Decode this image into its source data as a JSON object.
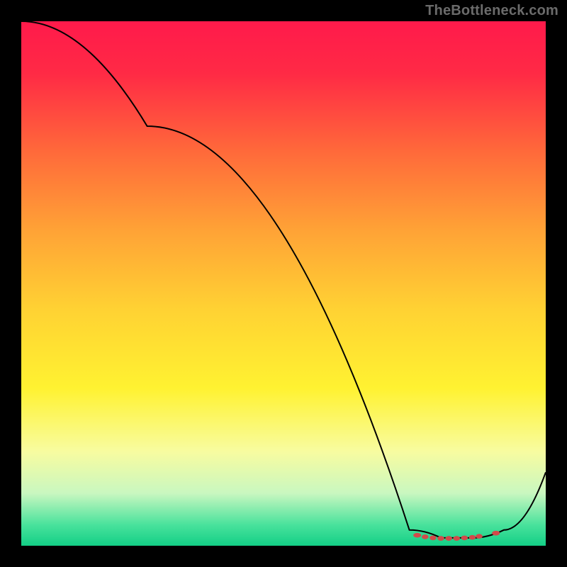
{
  "watermark": "TheBottleneck.com",
  "chart_data": {
    "type": "line",
    "title": "",
    "xlabel": "",
    "ylabel": "",
    "xlim": [
      0,
      100
    ],
    "ylim": [
      0,
      100
    ],
    "grid": false,
    "gradient_stops": [
      {
        "offset": 0.0,
        "color": "#ff1a4b"
      },
      {
        "offset": 0.1,
        "color": "#ff2a45"
      },
      {
        "offset": 0.25,
        "color": "#ff6a3a"
      },
      {
        "offset": 0.4,
        "color": "#ffa336"
      },
      {
        "offset": 0.55,
        "color": "#ffd233"
      },
      {
        "offset": 0.7,
        "color": "#fff231"
      },
      {
        "offset": 0.82,
        "color": "#f8fca0"
      },
      {
        "offset": 0.9,
        "color": "#c9f7c0"
      },
      {
        "offset": 0.96,
        "color": "#49e29c"
      },
      {
        "offset": 1.0,
        "color": "#13cf86"
      }
    ],
    "series": [
      {
        "name": "bottleneck-curve",
        "x": [
          0,
          24,
          74,
          80,
          86,
          92,
          100
        ],
        "y": [
          100,
          80,
          3,
          1.5,
          1.5,
          3,
          14
        ]
      }
    ],
    "markers": {
      "name": "optimal-range",
      "color": "#d24a4a",
      "points": [
        {
          "x": 75.5,
          "y": 2.0
        },
        {
          "x": 77.0,
          "y": 1.7
        },
        {
          "x": 78.5,
          "y": 1.5
        },
        {
          "x": 80.0,
          "y": 1.4
        },
        {
          "x": 81.5,
          "y": 1.4
        },
        {
          "x": 83.0,
          "y": 1.4
        },
        {
          "x": 84.5,
          "y": 1.5
        },
        {
          "x": 86.0,
          "y": 1.6
        },
        {
          "x": 87.3,
          "y": 1.8
        },
        {
          "x": 90.5,
          "y": 2.4
        }
      ]
    }
  }
}
